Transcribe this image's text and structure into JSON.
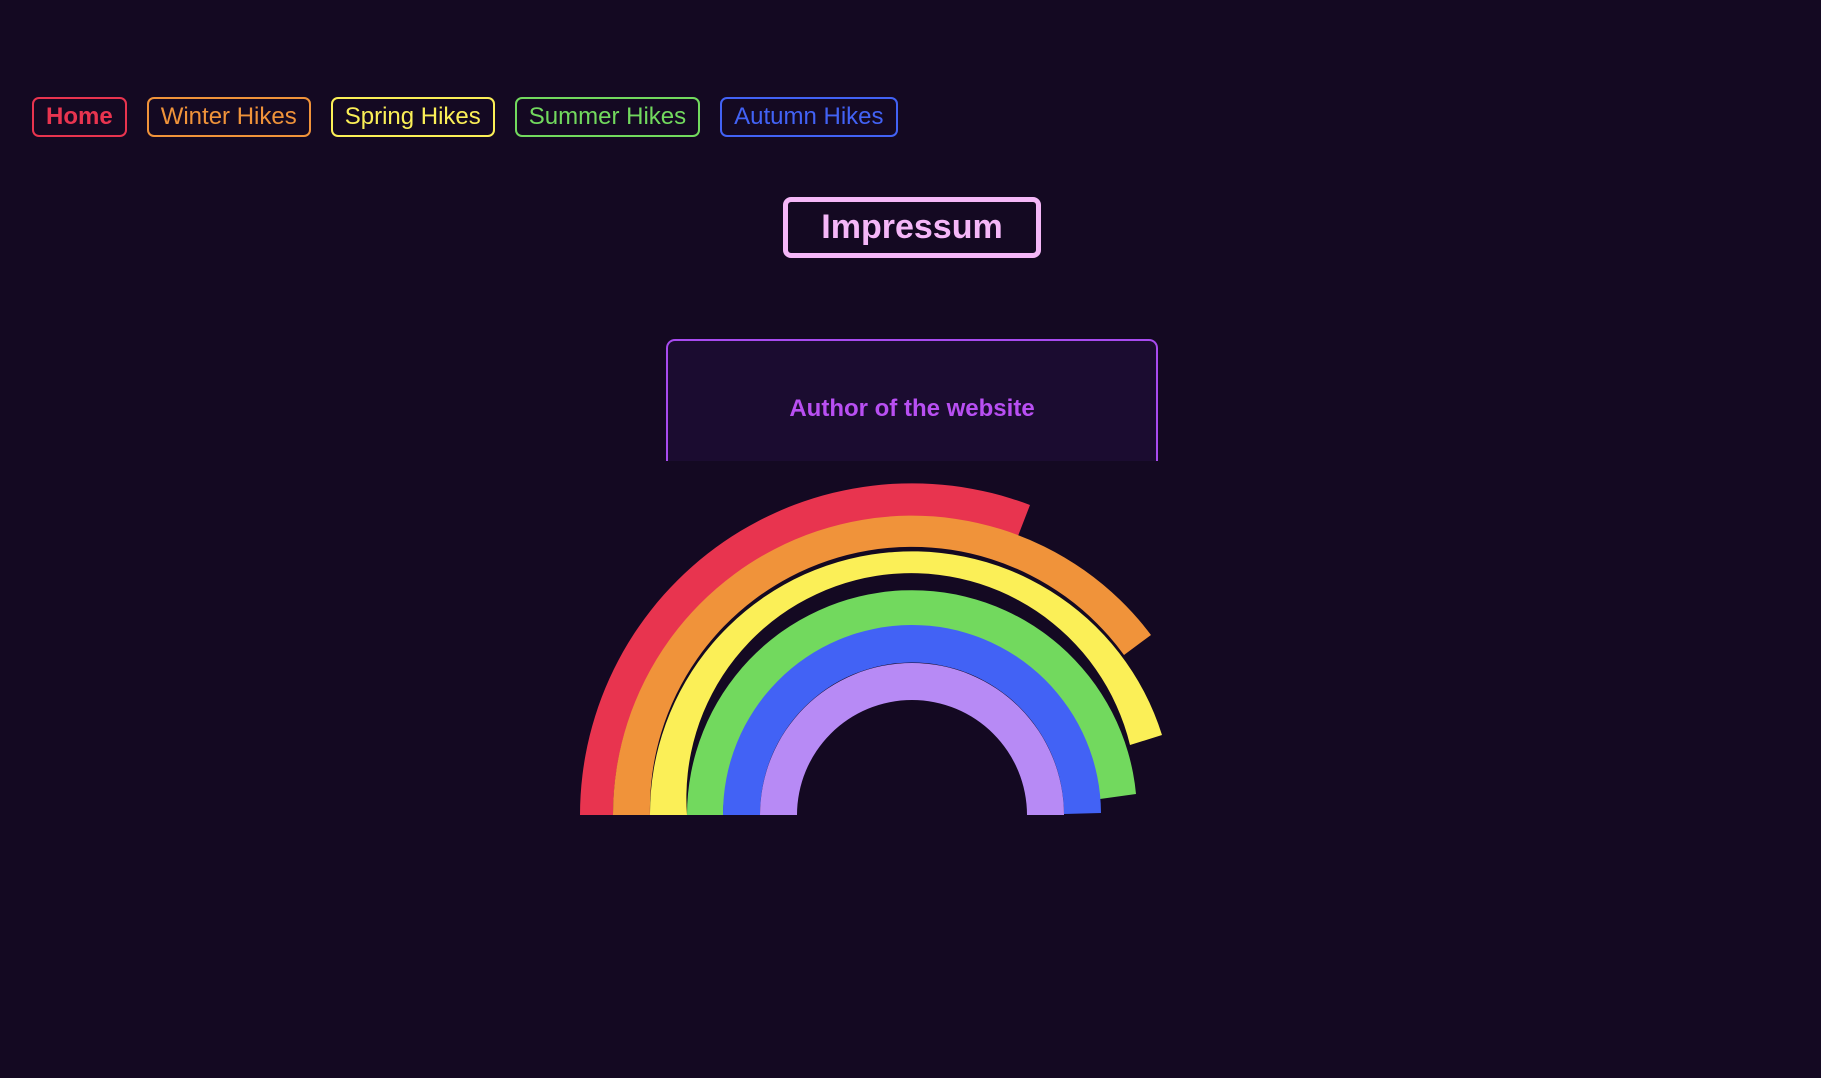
{
  "nav": {
    "items": [
      {
        "label": "Home",
        "color": "#e8344f",
        "active": true
      },
      {
        "label": "Winter Hikes",
        "color": "#f0933a"
      },
      {
        "label": "Spring Hikes",
        "color": "#fbef57"
      },
      {
        "label": "Summer Hikes",
        "color": "#72d95e"
      },
      {
        "label": "Autumn Hikes",
        "color": "#4262f5"
      }
    ]
  },
  "header": {
    "title": "Impressum",
    "title_color": "#f5b7f8"
  },
  "author_card": {
    "label": "Author of the website",
    "color": "#b84ff2"
  },
  "rainbow": {
    "band_colors": [
      "#e8344f",
      "#f0933a",
      "#fbef57",
      "#72d95e",
      "#4262f5",
      "#b78af5"
    ]
  },
  "colors": {
    "background": "#140922"
  }
}
